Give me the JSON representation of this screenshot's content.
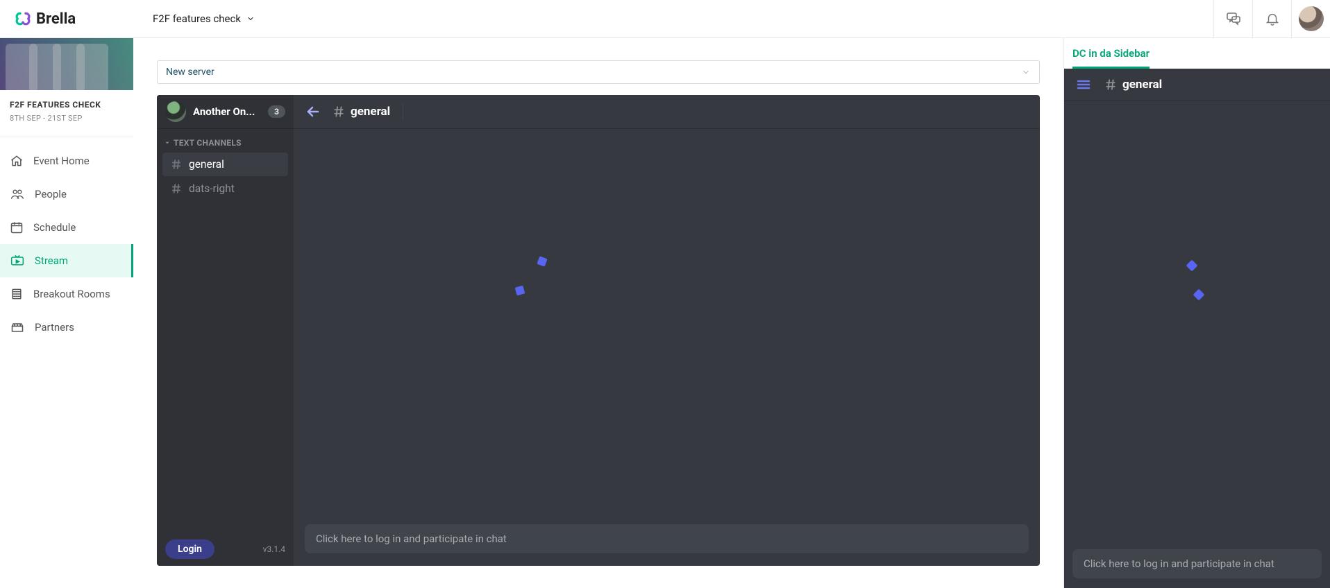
{
  "brand": "Brella",
  "header": {
    "context_label": "F2F features check"
  },
  "event": {
    "title": "F2F FEATURES CHECK",
    "dates": "8TH SEP - 21ST SEP"
  },
  "nav": [
    {
      "id": "home",
      "label": "Event Home"
    },
    {
      "id": "people",
      "label": "People"
    },
    {
      "id": "schedule",
      "label": "Schedule"
    },
    {
      "id": "stream",
      "label": "Stream"
    },
    {
      "id": "breakout",
      "label": "Breakout Rooms"
    },
    {
      "id": "partners",
      "label": "Partners"
    }
  ],
  "nav_active": "stream",
  "server_select_label": "New server",
  "widget": {
    "guild_name": "Another On...",
    "badge": "3",
    "section_label": "TEXT CHANNELS",
    "channels": [
      {
        "name": "general",
        "selected": true
      },
      {
        "name": "dats-right",
        "selected": false
      }
    ],
    "login_label": "Login",
    "version": "v3.1.4",
    "current_channel": "general",
    "input_placeholder": "Click here to log in and participate in chat"
  },
  "side": {
    "tab_label": "DC in da Sidebar",
    "current_channel": "general",
    "input_placeholder": "Click here to log in and participate in chat"
  }
}
